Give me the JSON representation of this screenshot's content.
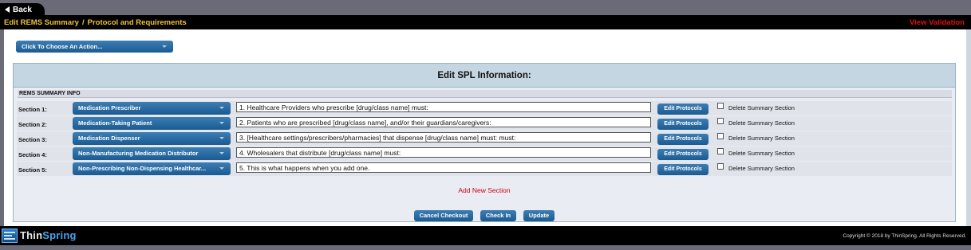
{
  "nav": {
    "back_label": "Back"
  },
  "header": {
    "breadcrumb_1": "Edit REMS Summary",
    "separator": "/",
    "breadcrumb_2": "Protocol and Requirements",
    "view_validation": "View Validation"
  },
  "action_menu": {
    "label": "Click To Choose An Action..."
  },
  "panel": {
    "title": "Edit SPL Information:",
    "section_header": "REMS SUMMARY INFO",
    "sections": [
      {
        "label": "Section 1:",
        "type": "Medication Prescriber",
        "text": "1. Healthcare Providers who prescribe [drug/class name] must:",
        "edit_label": "Edit Protocols",
        "delete_label": "Delete Summary Section"
      },
      {
        "label": "Section 2:",
        "type": "Medication-Taking Patient",
        "text": "2. Patients who are prescribed [drug/class name], and/or their guardians/caregivers:",
        "edit_label": "Edit Protocols",
        "delete_label": "Delete Summary Section"
      },
      {
        "label": "Section 3:",
        "type": "Medication Dispenser",
        "text": "3. [Healthcare settings/prescribers/pharmacies] that dispense [drug/class name] must: must:",
        "edit_label": "Edit Protocols",
        "delete_label": "Delete Summary Section"
      },
      {
        "label": "Section 4:",
        "type": "Non-Manufacturing Medication Distributor",
        "text": "4. Wholesalers that distribute [drug/class name] must:",
        "edit_label": "Edit Protocols",
        "delete_label": "Delete Summary Section"
      },
      {
        "label": "Section 5:",
        "type": "Non-Prescribing Non-Dispensing Healthcar...",
        "text": "5. This is what happens when you add one.",
        "edit_label": "Edit Protocols",
        "delete_label": "Delete Summary Section"
      }
    ],
    "add_new_label": "Add New Section",
    "buttons": {
      "cancel": "Cancel Checkout",
      "checkin": "Check In",
      "update": "Update"
    }
  },
  "footer": {
    "logo_thin": "Thin",
    "logo_spring": "Spring",
    "copyright": "Copyright © 2018 by ThinSpring. All Rights Reserved."
  },
  "colors": {
    "accent": "#1b5b92",
    "breadcrumb": "#f0c238",
    "alert": "#dd1111"
  }
}
